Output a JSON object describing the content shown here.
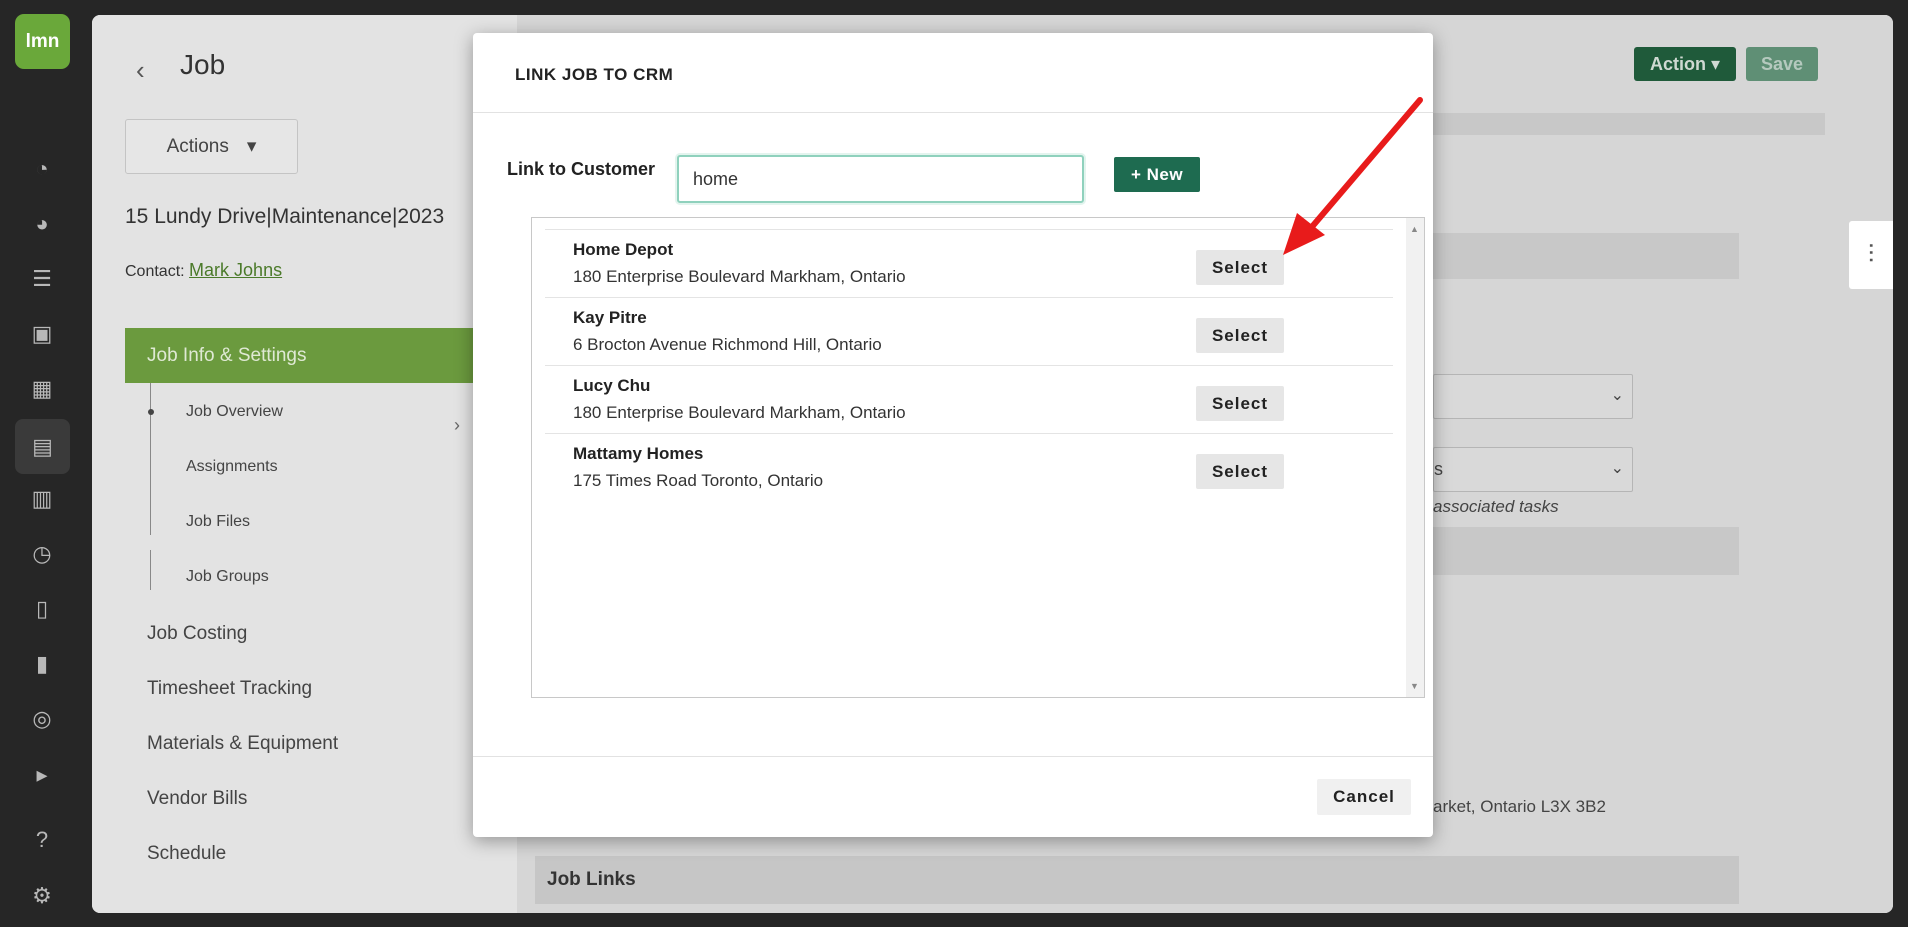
{
  "rail": {
    "logo": "lmn",
    "icons": [
      "dashboard-icon",
      "pie-chart-icon",
      "list-icon",
      "contact-card-icon",
      "calculator-icon",
      "building-icon",
      "calendar-icon",
      "clock-icon",
      "invoice-icon",
      "report-icon",
      "quickbooks-icon",
      "play-icon",
      "help-icon",
      "settings-icon"
    ]
  },
  "page": {
    "title": "Job",
    "actions_label": "Actions",
    "job_name": "15 Lundy Drive|Maintenance|2023",
    "contact_label": "Contact:",
    "contact_name": "Mark Johns"
  },
  "sidebar": {
    "active_section": "Job Info & Settings",
    "sub_items": [
      "Job Overview",
      "Assignments",
      "Job Files",
      "Job Groups"
    ],
    "sections": [
      "Job Costing",
      "Timesheet Tracking",
      "Materials & Equipment",
      "Vendor Bills",
      "Schedule"
    ]
  },
  "topbar": {
    "action_label": "Action",
    "save_label": "Save"
  },
  "background": {
    "associated_text": "associated tasks",
    "select_text": "s",
    "address_fragment": "arket, Ontario L3X 3B2",
    "job_links": "Job Links"
  },
  "modal": {
    "title": "LINK JOB TO CRM",
    "link_label": "Link to Customer",
    "search_value": "home",
    "new_label": "+ New",
    "select_label": "Select",
    "cancel_label": "Cancel",
    "results": [
      {
        "name": "Home Depot",
        "address": "180 Enterprise Boulevard Markham, Ontario"
      },
      {
        "name": "Kay Pitre",
        "address": "6 Brocton Avenue Richmond Hill, Ontario"
      },
      {
        "name": "Lucy Chu",
        "address": "180 Enterprise Boulevard Markham, Ontario"
      },
      {
        "name": "Mattamy Homes",
        "address": "175 Times Road Toronto, Ontario"
      }
    ]
  },
  "colors": {
    "brand_green": "#6aa83a",
    "button_green": "#1e6b50",
    "annotation_arrow": "#e81b1b"
  }
}
